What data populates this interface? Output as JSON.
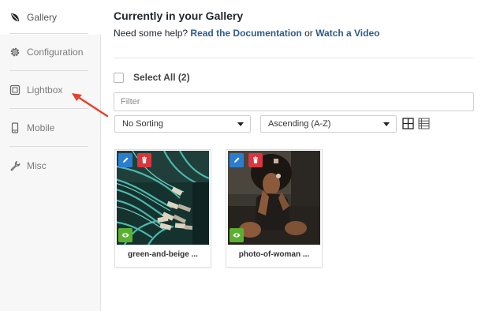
{
  "sidebar": {
    "items": [
      {
        "label": "Gallery",
        "icon": "leaf-icon",
        "active": true
      },
      {
        "label": "Configuration",
        "icon": "gear-icon",
        "active": false
      },
      {
        "label": "Lightbox",
        "icon": "lightbox-icon",
        "active": false
      },
      {
        "label": "Mobile",
        "icon": "mobile-icon",
        "active": false
      },
      {
        "label": "Misc",
        "icon": "wrench-icon",
        "active": false
      }
    ]
  },
  "main": {
    "title": "Currently in your Gallery",
    "help_prefix": "Need some help?",
    "docs_link": "Read the Documentation",
    "help_or": "or",
    "video_link": "Watch a Video",
    "select_all_label": "Select All (2)",
    "filter_placeholder": "Filter",
    "sort_select": "No Sorting",
    "order_select": "Ascending (A-Z)"
  },
  "gallery": {
    "items": [
      {
        "caption": "green-and-beige ..."
      },
      {
        "caption": "photo-of-woman ..."
      }
    ]
  },
  "colors": {
    "link": "#2e5b8a",
    "edit_button": "#2a7dcf",
    "delete_button": "#d9363e",
    "view_button": "#5cb030",
    "annotation_arrow": "#e8402b"
  }
}
